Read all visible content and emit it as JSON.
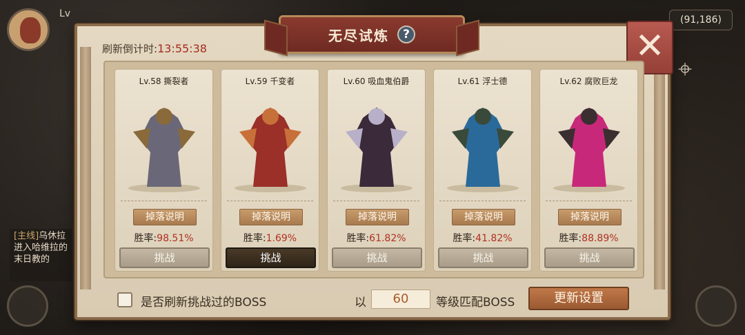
{
  "hud": {
    "level_label": "Lv",
    "coordinates": "(91,186)",
    "quest_tag": "[主线]",
    "quest_text": "乌休拉 进入哈维拉的末日教的"
  },
  "dialog": {
    "title": "无尽试炼",
    "help_glyph": "?",
    "close_glyph": "✕",
    "refresh_label": "刷新倒计时:",
    "refresh_time": "13:55:38",
    "drop_label": "掉落说明",
    "win_rate_label": "胜率:",
    "challenge_label": "挑战",
    "bosses": [
      {
        "level": "Lv.58",
        "name": "撕裂者",
        "win_rate": "98.51%",
        "challenge_active": false,
        "color": "#6a6878",
        "accent": "#8a6a3a"
      },
      {
        "level": "Lv.59",
        "name": "千变者",
        "win_rate": "1.69%",
        "challenge_active": true,
        "color": "#9a3028",
        "accent": "#c8703a"
      },
      {
        "level": "Lv.60",
        "name": "吸血鬼伯爵",
        "win_rate": "61.82%",
        "challenge_active": false,
        "color": "#3a2a3a",
        "accent": "#b8b0c8"
      },
      {
        "level": "Lv.61",
        "name": "浮士德",
        "win_rate": "41.82%",
        "challenge_active": false,
        "color": "#2a6a9a",
        "accent": "#3a4a3a"
      },
      {
        "level": "Lv.62",
        "name": "腐败巨龙",
        "win_rate": "88.89%",
        "challenge_active": false,
        "color": "#c8287a",
        "accent": "#3a2e30"
      }
    ],
    "checkbox_label": "是否刷新挑战过的BOSS",
    "level_prefix": "以",
    "level_value": "60",
    "level_suffix": "等级匹配BOSS",
    "update_button": "更新设置"
  }
}
